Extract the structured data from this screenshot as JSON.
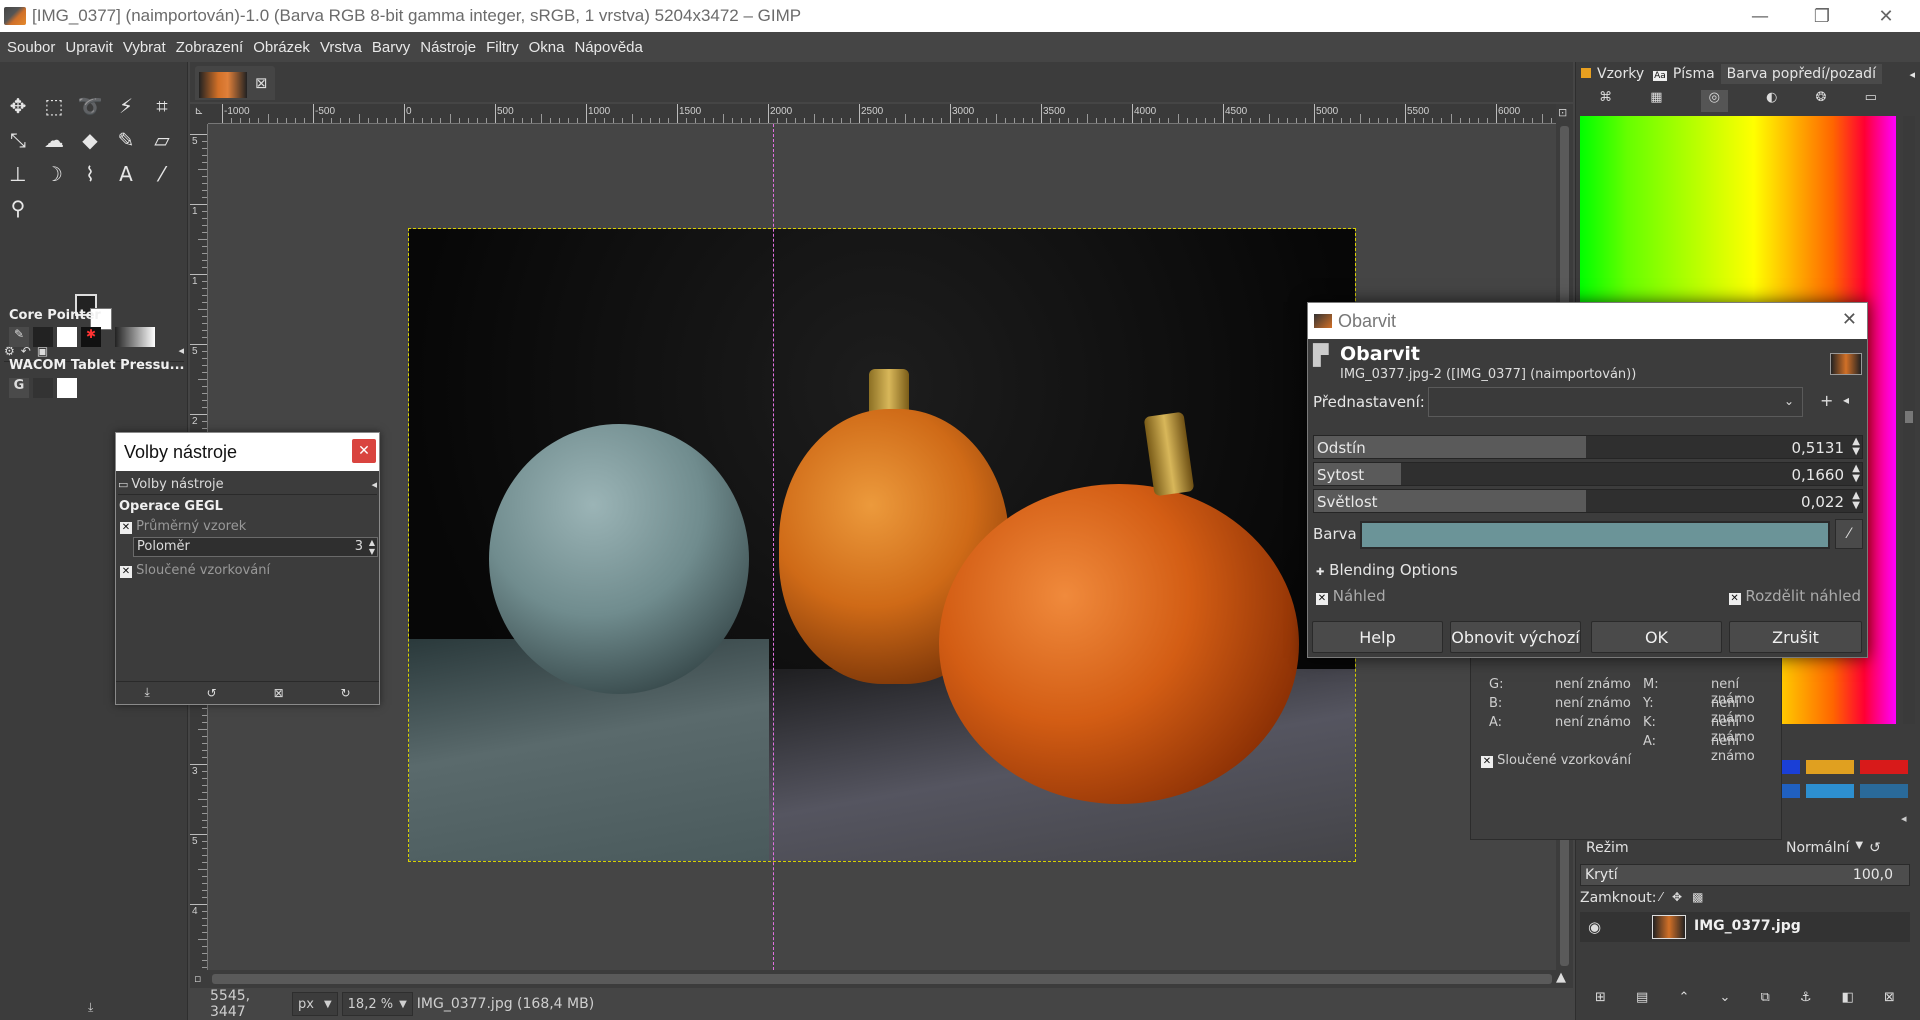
{
  "window": {
    "title": "[IMG_0377] (naimportován)-1.0 (Barva RGB 8-bit gamma integer, sRGB, 1 vrstva) 5204x3472 – GIMP",
    "minimize": "—",
    "maximize": "❐",
    "close": "✕"
  },
  "menu": [
    "Soubor",
    "Upravit",
    "Vybrat",
    "Zobrazení",
    "Obrázek",
    "Vrstva",
    "Barvy",
    "Nástroje",
    "Filtry",
    "Okna",
    "Nápověda"
  ],
  "toolbox": {
    "devices": [
      {
        "name": "Core Pointer"
      },
      {
        "name": "WACOM Tablet Pressu..."
      }
    ]
  },
  "tool_options": {
    "window_title": "Volby nástroje",
    "tab_label": "Volby nástroje",
    "section": "Operace GEGL",
    "sample_average": "Průměrný vzorek",
    "radius_label": "Poloměr",
    "radius_value": "3",
    "sample_merged": "Sloučené vzorkování"
  },
  "ruler": {
    "h_ticks": [
      "-1000",
      "-500",
      "0",
      "500",
      "1000",
      "1500",
      "2000",
      "2500",
      "3000",
      "3500",
      "4000",
      "4500",
      "5000",
      "5500",
      "6000"
    ],
    "v_ticks": [
      "5",
      "1",
      "1",
      "5",
      "2",
      "2",
      "5",
      "3",
      "0",
      "3",
      "5",
      "4"
    ]
  },
  "status": {
    "coords": "5545, 3447",
    "unit": "px",
    "zoom": "18,2 %",
    "file_info": "IMG_0377.jpg (168,4 MB)"
  },
  "right_dock": {
    "tabs": [
      "Vzorky",
      "Písma",
      "Barva popředí/pozadí"
    ]
  },
  "pointer_info": {
    "rows": [
      {
        "label": "G:",
        "value": "není známo",
        "label2": "M:",
        "value2": "není známo"
      },
      {
        "label": "B:",
        "value": "není známo",
        "label2": "Y:",
        "value2": "není známo"
      },
      {
        "label": "A:",
        "value": "není známo",
        "label2": "K:",
        "value2": "není známo"
      },
      {
        "label": "",
        "value": "",
        "label2": "A:",
        "value2": "není známo"
      }
    ],
    "sample_merged": "Sloučené vzorkování"
  },
  "palette": {
    "colors": [
      "#1a3fd6",
      "#e0a020",
      "#d81a1a",
      "#2060c0",
      "#2d8fd0",
      "#2a6a9a"
    ]
  },
  "layers": {
    "mode_label": "Režim",
    "mode_value": "Normální",
    "opacity_label": "Krytí",
    "opacity_value": "100,0",
    "lock_label": "Zamknout:",
    "layer_name": "IMG_0377.jpg"
  },
  "colorize": {
    "window_title": "Obarvit",
    "heading": "Obarvit",
    "subtitle": "IMG_0377.jpg-2 ([IMG_0377] (naimportován))",
    "presets_label": "Přednastavení:",
    "hue_label": "Odstín",
    "hue_value": "0,5131",
    "saturation_label": "Sytost",
    "saturation_value": "0,1660",
    "lightness_label": "Světlost",
    "lightness_value": "0,022",
    "color_label": "Barva",
    "color_swatch": "#6b9498",
    "blending": "Blending Options",
    "preview": "Náhled",
    "split_preview": "Rozdělit náhled",
    "buttons": {
      "help": "Help",
      "reset": "Obnovit výchozí",
      "ok": "OK",
      "cancel": "Zrušit"
    }
  }
}
